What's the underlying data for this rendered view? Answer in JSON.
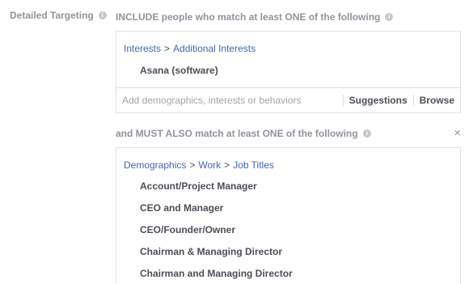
{
  "detailed_targeting": {
    "label": "Detailed Targeting",
    "info_icon": "info-icon"
  },
  "include": {
    "heading": "INCLUDE people who match at least ONE of the following",
    "breadcrumb": [
      "Interests",
      ">",
      "Additional Interests"
    ],
    "items": [
      "Asana (software)"
    ],
    "search_placeholder": "Add demographics, interests or behaviors",
    "suggestions_label": "Suggestions",
    "browse_label": "Browse"
  },
  "must_also": {
    "heading": "and MUST ALSO match at least ONE of the following",
    "close_label": "×",
    "breadcrumb": [
      "Demographics",
      ">",
      "Work",
      ">",
      "Job Titles"
    ],
    "items": [
      "Account/Project Manager",
      "CEO and Manager",
      "CEO/Founder/Owner",
      "Chairman & Managing Director",
      "Chairman and Managing Director"
    ]
  },
  "colors": {
    "link": "#4267b2",
    "muted": "#90949c",
    "text": "#4b4f56",
    "border": "#dddfe2"
  }
}
